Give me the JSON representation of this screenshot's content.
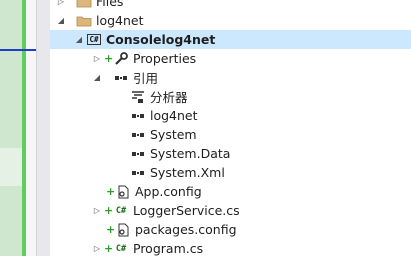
{
  "tree": [
    {
      "label": "Files",
      "icon": "folder-icon"
    },
    {
      "label": "log4net",
      "icon": "folder-icon"
    },
    {
      "label": "Consolelog4net",
      "icon": "csharp-project-icon",
      "selected": true
    },
    {
      "label": "Properties",
      "icon": "wrench-icon"
    },
    {
      "label": "引用",
      "icon": "references-icon"
    },
    {
      "label": "分析器",
      "icon": "analyzer-icon"
    },
    {
      "label": "log4net",
      "icon": "reference-icon"
    },
    {
      "label": "System",
      "icon": "reference-icon"
    },
    {
      "label": "System.Data",
      "icon": "reference-icon"
    },
    {
      "label": "System.Xml",
      "icon": "reference-icon"
    },
    {
      "label": "App.config",
      "icon": "config-file-icon"
    },
    {
      "label": "LoggerService.cs",
      "icon": "csharp-file-icon"
    },
    {
      "label": "packages.config",
      "icon": "config-file-icon"
    },
    {
      "label": "Program.cs",
      "icon": "csharp-file-icon"
    }
  ]
}
